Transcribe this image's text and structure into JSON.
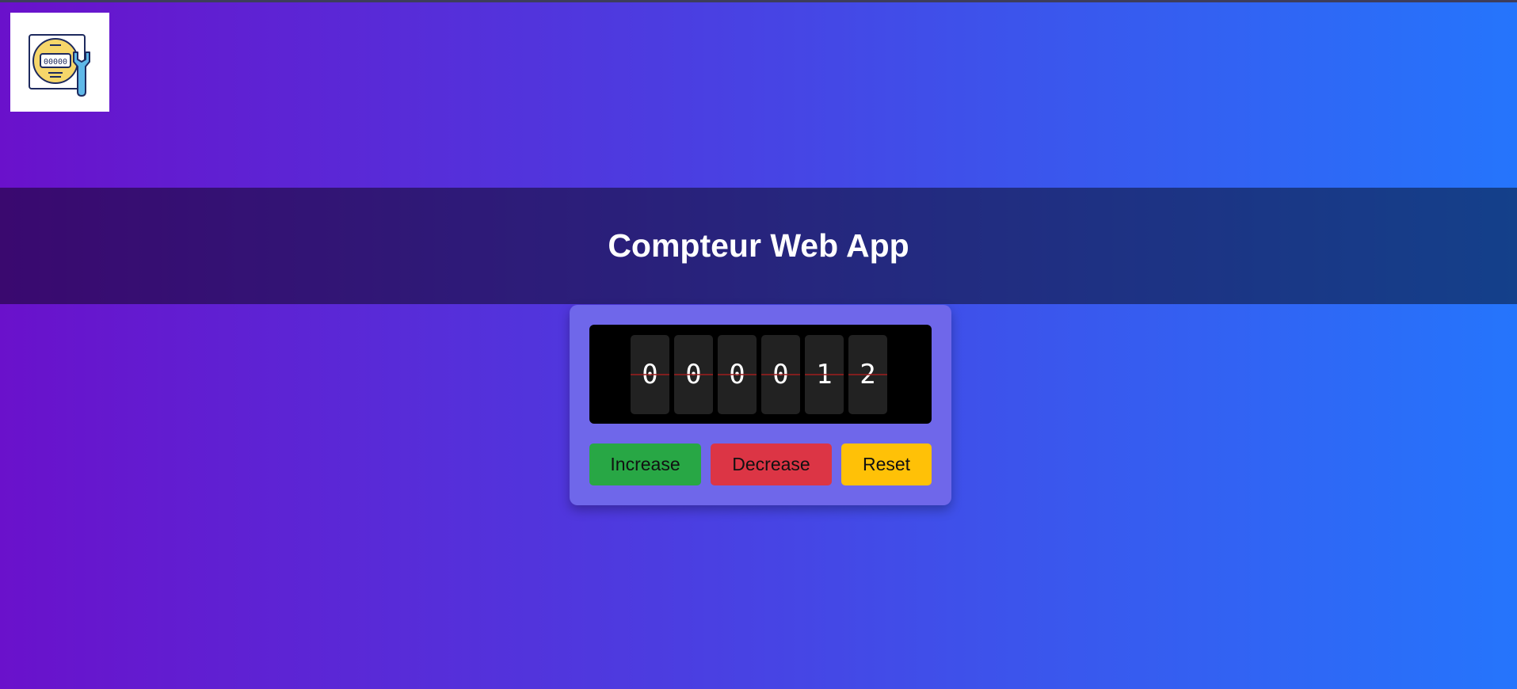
{
  "app": {
    "title": "Compteur Web App"
  },
  "logo": {
    "icon": "meter-wrench-icon",
    "meter_text": "00000"
  },
  "counter": {
    "digits": [
      "0",
      "0",
      "0",
      "0",
      "1",
      "2"
    ]
  },
  "buttons": {
    "increase": "Increase",
    "decrease": "Decrease",
    "reset": "Reset"
  },
  "colors": {
    "gradient_start": "#6a11cb",
    "gradient_end": "#2575fc",
    "card": "#6f67ea",
    "increase": "#28a745",
    "decrease": "#dc3545",
    "reset": "#ffc107"
  }
}
